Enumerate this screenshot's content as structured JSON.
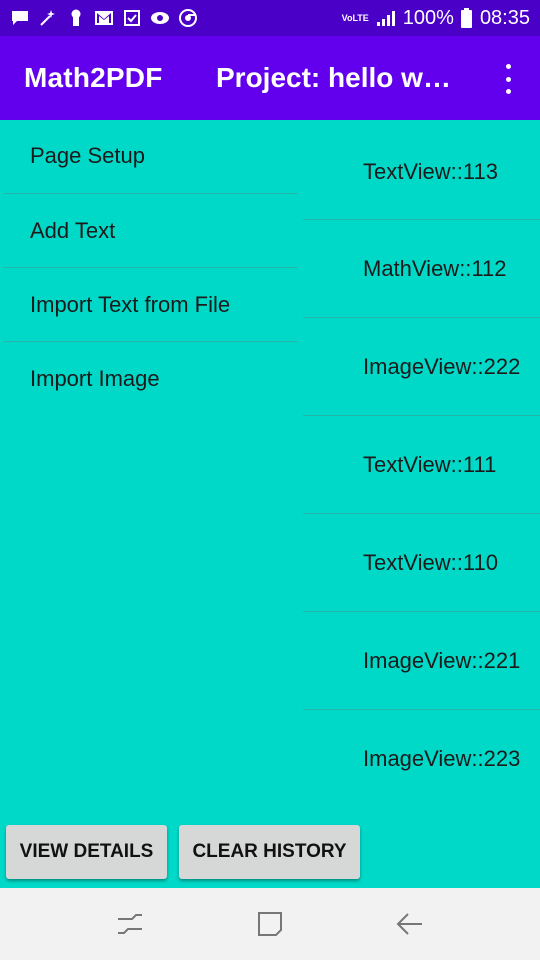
{
  "status_bar": {
    "left_icons": [
      "message-icon",
      "magic-wand-icon",
      "keyhole-icon",
      "gmail-icon",
      "checkbox-icon",
      "eye-icon",
      "chrome-icon"
    ],
    "network": "VoLTE",
    "battery": "100%",
    "time": "08:35"
  },
  "app_bar": {
    "title": "Math2PDF",
    "project": "Project: hello world",
    "menu_icon": "more-vert-icon"
  },
  "menu": {
    "items": [
      {
        "label": "Page Setup"
      },
      {
        "label": "Add Text"
      },
      {
        "label": "Import Text from File"
      },
      {
        "label": "Import Image"
      }
    ]
  },
  "history": {
    "items": [
      {
        "label": "TextView::113"
      },
      {
        "label": "MathView::112"
      },
      {
        "label": "ImageView::222"
      },
      {
        "label": "TextView::111"
      },
      {
        "label": "TextView::110"
      },
      {
        "label": "ImageView::221"
      },
      {
        "label": "ImageView::223"
      }
    ]
  },
  "buttons": {
    "view_details": "VIEW DETAILS",
    "clear_history": "CLEAR HISTORY"
  },
  "nav_bar": {
    "icons": [
      "recents-icon",
      "home-icon",
      "back-icon"
    ]
  },
  "colors": {
    "status_bar": "#4b00c8",
    "app_bar": "#6200ee",
    "background": "#00d9c8",
    "button": "#d6d7d7",
    "nav_bar": "#f2f2f2"
  }
}
